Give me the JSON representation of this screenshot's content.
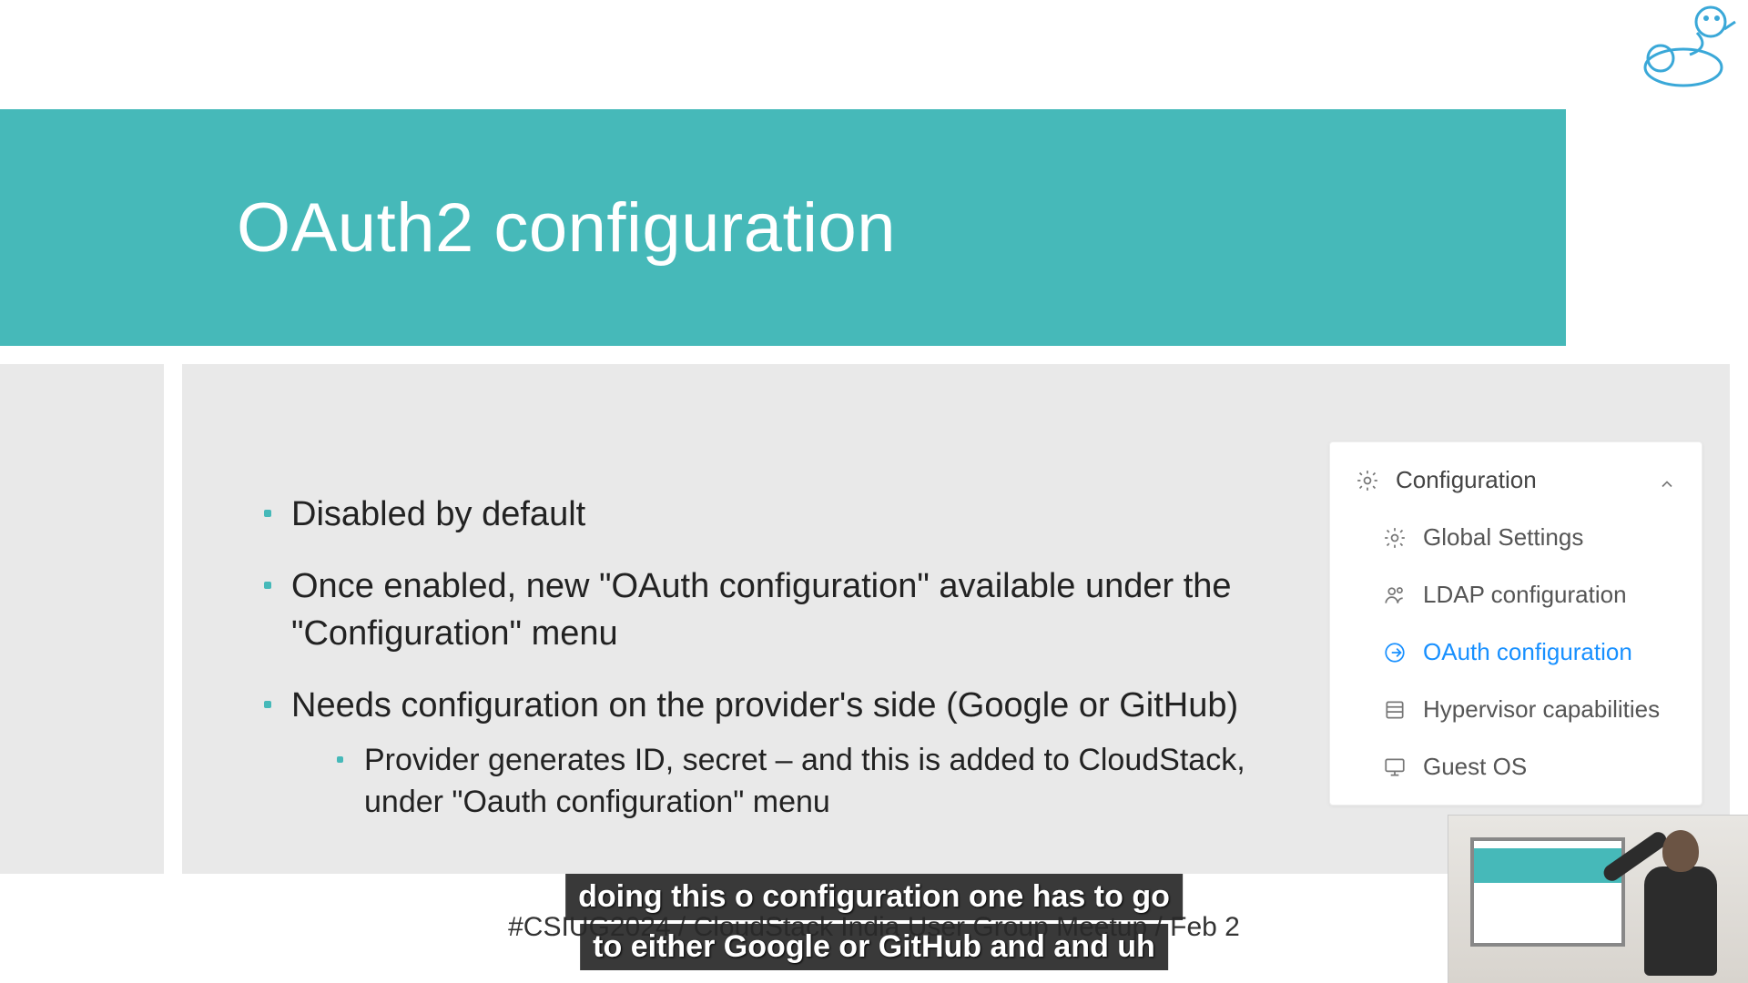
{
  "title": "OAuth2 configuration",
  "bullets": [
    {
      "text": "Disabled by default"
    },
    {
      "text": "Once enabled, new \"OAuth configuration\" available under the \"Configuration\" menu"
    },
    {
      "text": "Needs configuration on the provider's side (Google or GitHub)",
      "sub": [
        "Provider generates ID, secret – and this is added to CloudStack, under \"Oauth configuration\" menu"
      ]
    }
  ],
  "menu": {
    "header": "Configuration",
    "items": [
      {
        "label": "Global Settings",
        "icon": "gear",
        "active": false
      },
      {
        "label": "LDAP configuration",
        "icon": "users",
        "active": false
      },
      {
        "label": "OAuth configuration",
        "icon": "login",
        "active": true
      },
      {
        "label": "Hypervisor capabilities",
        "icon": "list",
        "active": false
      },
      {
        "label": "Guest OS",
        "icon": "monitor",
        "active": false
      }
    ]
  },
  "footer": "#CSIUG2024 / CloudStack India User Group Meetup / Feb 2",
  "caption": {
    "line1": "doing this o configuration one has to go",
    "line2": "to either Google or GitHub and and uh"
  },
  "colors": {
    "accent": "#46b9b9",
    "link": "#1890ff"
  }
}
